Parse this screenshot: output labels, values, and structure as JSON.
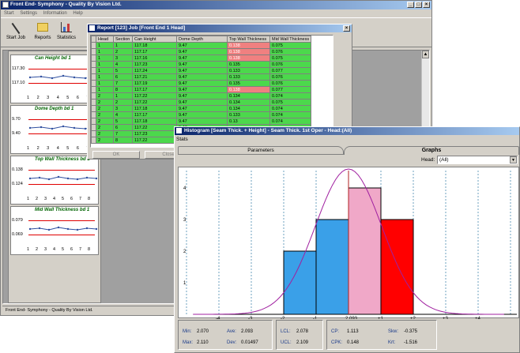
{
  "main_window": {
    "title": "Front End- Symphony - Quality By Vision Ltd.",
    "menu": [
      "Start",
      "Settings",
      "Information",
      "Help"
    ],
    "toolbar": [
      "Start Job",
      "Reports",
      "Statistics"
    ],
    "status": "Front End- Symphony - Quality By Vision Ltd.",
    "minimize": "_",
    "maximize": "□",
    "close": "×"
  },
  "side_charts": [
    {
      "title": "Can Height bd 1",
      "yticks": [
        "117.30",
        "117.10"
      ],
      "xticks": [
        "1",
        "2",
        "3",
        "4",
        "5",
        "6",
        "7"
      ]
    },
    {
      "title": "Dome Depth bd 1",
      "yticks": [
        "9.70",
        "9.40"
      ],
      "xticks": [
        "1",
        "2",
        "3",
        "4",
        "5",
        "6",
        "7"
      ]
    },
    {
      "title": "Top Wall Thickness bd 1",
      "yticks": [
        "0.138",
        "0.124"
      ],
      "xticks": [
        "1",
        "2",
        "3",
        "4",
        "5",
        "6",
        "7",
        "8"
      ]
    },
    {
      "title": "Mid Wall Thickness bd 1",
      "yticks": [
        "0.079",
        "0.069"
      ],
      "xticks": [
        "1",
        "2",
        "3",
        "4",
        "5",
        "6",
        "7",
        "8"
      ]
    }
  ],
  "report_window": {
    "title": "Report [123] Job [Front End 1 Head]",
    "close": "×",
    "columns": [
      "Head",
      "Section",
      "Can Height",
      "Dome Depth",
      "Top Wall Thickness",
      "Mid Wall Thickness"
    ],
    "rows": [
      [
        "1",
        "1",
        "117.18",
        "9.47",
        "0.138",
        "0.075"
      ],
      [
        "1",
        "2",
        "117.17",
        "9.47",
        "0.138",
        "0.076"
      ],
      [
        "1",
        "3",
        "117.16",
        "9.47",
        "0.138",
        "0.075"
      ],
      [
        "1",
        "4",
        "117.23",
        "9.47",
        "0.135",
        "0.076"
      ],
      [
        "1",
        "5",
        "117.24",
        "9.47",
        "0.133",
        "0.077"
      ],
      [
        "1",
        "6",
        "117.21",
        "9.47",
        "0.133",
        "0.076"
      ],
      [
        "1",
        "7",
        "117.19",
        "9.47",
        "0.135",
        "0.076"
      ],
      [
        "1",
        "8",
        "117.17",
        "9.47",
        "0.138",
        "0.077"
      ],
      [
        "2",
        "1",
        "117.22",
        "9.47",
        "0.134",
        "0.074"
      ],
      [
        "2",
        "2",
        "117.22",
        "9.47",
        "0.134",
        "0.075"
      ],
      [
        "2",
        "3",
        "117.18",
        "9.47",
        "0.134",
        "0.074"
      ],
      [
        "2",
        "4",
        "117.17",
        "9.47",
        "0.133",
        "0.074"
      ],
      [
        "2",
        "5",
        "117.18",
        "9.47",
        "0.13",
        "0.074"
      ],
      [
        "2",
        "6",
        "117.22",
        "9.47",
        "",
        ""
      ],
      [
        "2",
        "7",
        "117.23",
        "9.47",
        "",
        ""
      ],
      [
        "2",
        "8",
        "117.22",
        "9.47",
        "",
        ""
      ]
    ],
    "red_cells": [
      [
        0,
        4
      ],
      [
        1,
        4
      ],
      [
        2,
        4
      ],
      [
        7,
        4
      ]
    ],
    "ok_button": "OK",
    "close_button": "Close"
  },
  "histogram_window": {
    "title": "Histogram [Seam Thick. + Height] - Seam Thick. 1st Oper - Head:(All)",
    "menu": "Stats",
    "tab_parameters": "Parameters",
    "tab_graphs": "Graphs",
    "head_label": "Head:",
    "head_value": "(All)",
    "stats": {
      "min_label": "Min:",
      "min": "2.070",
      "max_label": "Max:",
      "max": "2.110",
      "ave_label": "Ave:",
      "ave": "2.093",
      "dev_label": "Dev:",
      "dev": "0.01497",
      "lcl_label": "LCL:",
      "lcl": "2.078",
      "ucl_label": "UCL:",
      "ucl": "2.109",
      "cp_label": "CP:",
      "cp": "1.113",
      "cpk_label": "CPK:",
      "cpk": "0.148",
      "skw_label": "Skw:",
      "skw": "-0.375",
      "krt_label": "Krt:",
      "krt": "-1.516"
    }
  },
  "chart_data": {
    "type": "bar",
    "categories": [
      "-2 to -1",
      "-1 to 2.093",
      "2.093 to +1",
      "+1 to +2"
    ],
    "values": [
      2,
      3,
      4,
      3
    ],
    "colors": [
      "#3aa0e8",
      "#3aa0e8",
      "#f0a8c8",
      "#ff0000"
    ],
    "x_ticks": [
      "-4",
      "-3",
      "-2",
      "-1",
      "2.093",
      "+1",
      "+2",
      "+3",
      "+4"
    ],
    "y_ticks": [
      "1",
      "2",
      "3",
      "4"
    ],
    "ylim": [
      0,
      4.3
    ],
    "curve": "normal",
    "grid": "dashed vertical"
  }
}
